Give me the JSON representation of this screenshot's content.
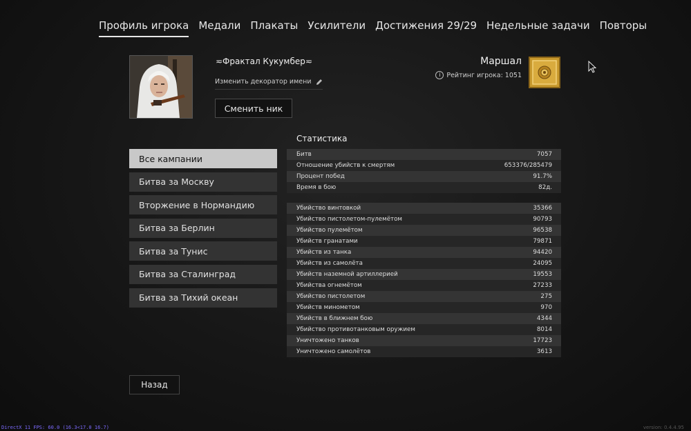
{
  "nav": {
    "tabs": [
      {
        "label": "Профиль игрока",
        "active": true
      },
      {
        "label": "Медали"
      },
      {
        "label": "Плакаты"
      },
      {
        "label": "Усилители"
      },
      {
        "label": "Достижения 29/29"
      },
      {
        "label": "Недельные задачи"
      },
      {
        "label": "Повторы"
      }
    ]
  },
  "profile": {
    "nickname": "≂Фрактал Кукумбер≂",
    "decorator_link": "Изменить декоратор имени",
    "change_nick_label": "Сменить ник",
    "avatar_icon": "soldier-portrait",
    "rank_title": "Маршал",
    "rating_label": "Рейтинг игрока: 1051",
    "rank_badge_color": "#c99a2e"
  },
  "campaigns": [
    {
      "label": "Все кампании",
      "active": true
    },
    {
      "label": "Битва за Москву"
    },
    {
      "label": "Вторжение в Нормандию"
    },
    {
      "label": "Битва за Берлин"
    },
    {
      "label": "Битва за Тунис"
    },
    {
      "label": "Битва за Сталинград"
    },
    {
      "label": "Битва за Тихий океан"
    }
  ],
  "stats": {
    "title": "Статистика",
    "summary": [
      {
        "label": "Битв",
        "value": "7057"
      },
      {
        "label": "Отношение убийств к смертям",
        "value": "653376/285479"
      },
      {
        "label": "Процент побед",
        "value": "91.7%"
      },
      {
        "label": "Время в бою",
        "value": "82д."
      }
    ],
    "kills": [
      {
        "label": "Убийство винтовкой",
        "value": "35366"
      },
      {
        "label": "Убийство пистолетом-пулемётом",
        "value": "90793"
      },
      {
        "label": "Убийство пулемётом",
        "value": "96538"
      },
      {
        "label": "Убийств гранатами",
        "value": "79871"
      },
      {
        "label": "Убийств из танка",
        "value": "94420"
      },
      {
        "label": "Убийств из самолёта",
        "value": "24095"
      },
      {
        "label": "Убийств наземной артиллерией",
        "value": "19553"
      },
      {
        "label": "Убийства огнемётом",
        "value": "27233"
      },
      {
        "label": "Убийство пистолетом",
        "value": "275"
      },
      {
        "label": "Убийств минометом",
        "value": "970"
      },
      {
        "label": "Убийств в ближнем бою",
        "value": "4344"
      },
      {
        "label": "Убийство противотанковым оружием",
        "value": "8014"
      },
      {
        "label": "Уничтожено танков",
        "value": "17723"
      },
      {
        "label": "Уничтожено самолётов",
        "value": "3613"
      }
    ]
  },
  "footer": {
    "back_label": "Назад",
    "fps_text": "DirectX 11 FPS: 60.0 (16.3<17.0 16.7)",
    "version_text": "version: 0.4.4.95"
  }
}
